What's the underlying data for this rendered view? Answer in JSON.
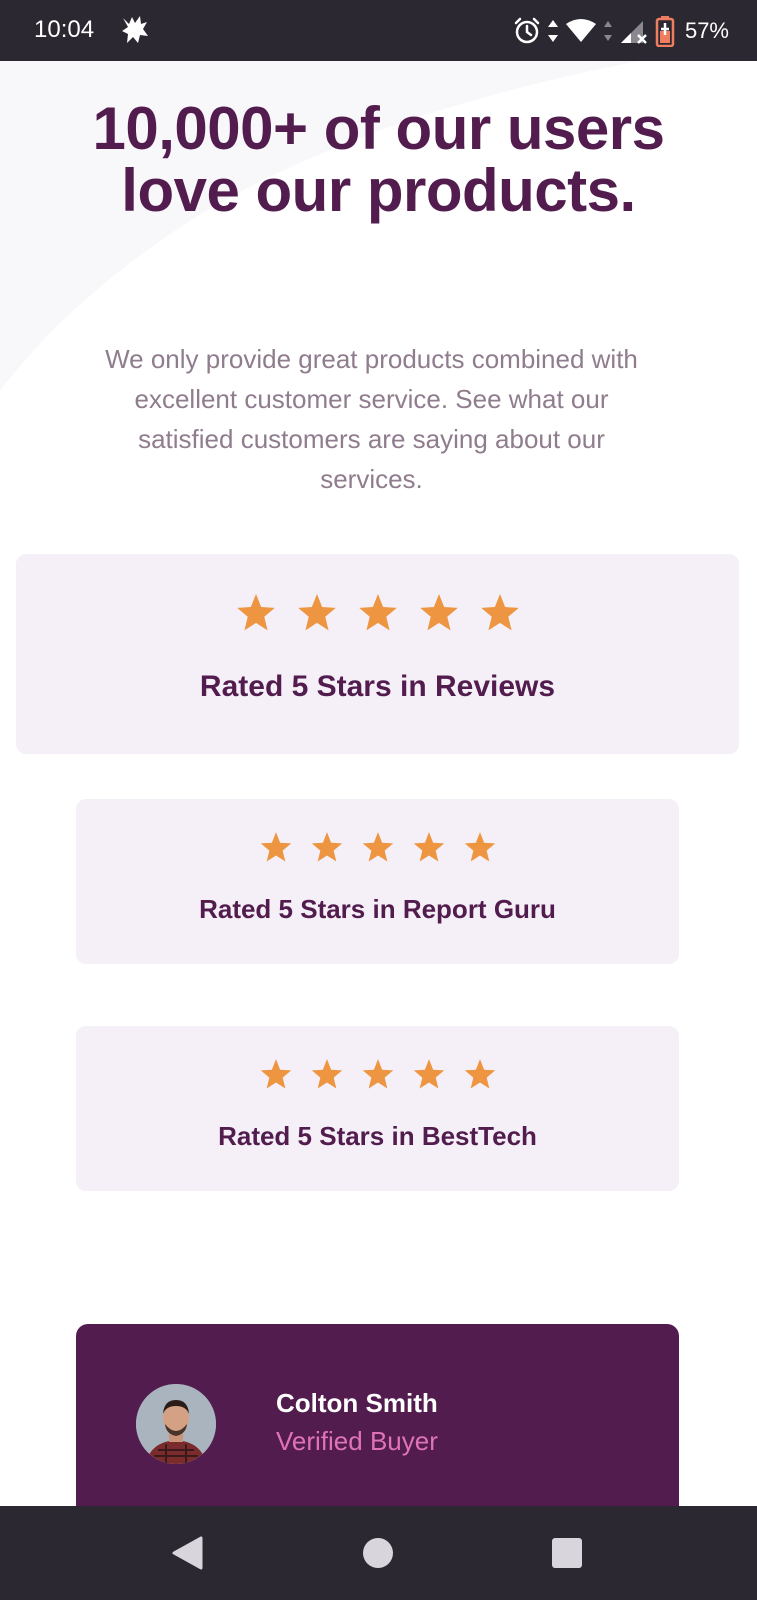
{
  "status_bar": {
    "time": "10:04",
    "battery_percent": "57%",
    "icons": [
      "app-notification-icon",
      "alarm-icon",
      "data-arrows-icon",
      "wifi-icon",
      "cell-signal-icon",
      "battery-icon"
    ]
  },
  "hero": {
    "headline": "10,000+ of our users love our products.",
    "subtext": "We only provide great products combined with excellent customer service. See what our satisfied customers are saying about our services."
  },
  "ratings": [
    {
      "stars": 5,
      "label": "Rated 5 Stars in Reviews"
    },
    {
      "stars": 5,
      "label": "Rated 5 Stars in Report Guru"
    },
    {
      "stars": 5,
      "label": "Rated 5 Stars in BestTech"
    }
  ],
  "testimonial": {
    "name": "Colton Smith",
    "role": "Verified Buyer"
  },
  "nav_bar": {
    "buttons": [
      "back-icon",
      "home-icon",
      "recents-icon"
    ]
  },
  "colors": {
    "primary": "#521d4e",
    "star": "#ee9541",
    "card_bg": "#f5f0f7",
    "accent_pink": "#e072b7",
    "muted_text": "#8f7d8e",
    "system_bar": "#2b2831"
  }
}
